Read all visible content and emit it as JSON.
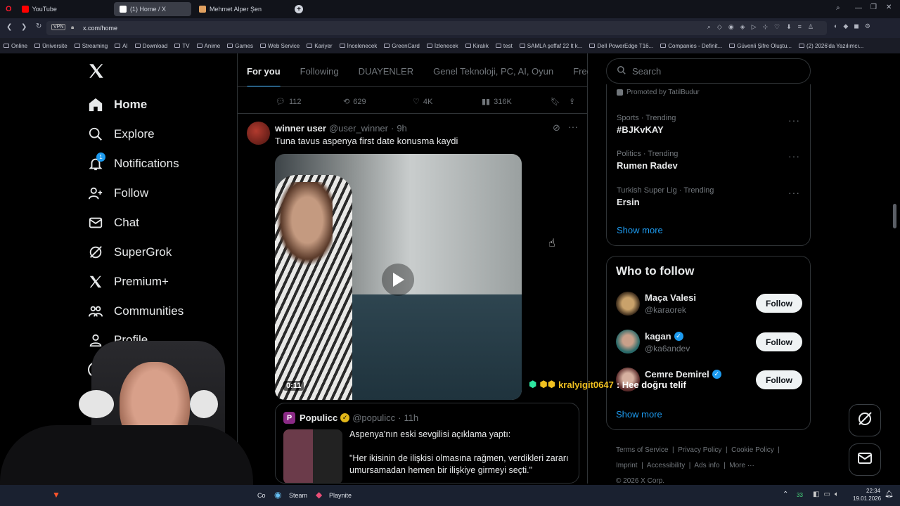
{
  "browser": {
    "tabs": [
      {
        "label": "YouTube",
        "color": "#ff0000"
      },
      {
        "label": "(1) Home / X",
        "color": "#ffffff"
      },
      {
        "label": "Mehmet Alper Şen",
        "color": "#e0a060"
      }
    ],
    "url": "x.com/home",
    "vpn_label": "VPN",
    "bookmarks": [
      "Online",
      "Üniversite",
      "Streaming",
      "AI",
      "Download",
      "TV",
      "Anime",
      "Games",
      "Web Service",
      "Kariyer",
      "İncelenecek",
      "GreenCard",
      "İzlenecek",
      "Kiralık",
      "test",
      "SAMLA şeffaf 22 lt k...",
      "Dell PowerEdge T16...",
      "Companies - Definit...",
      "Güvenli Şifre Oluştu...",
      "(2) 2026'da Yazılımcı..."
    ]
  },
  "nav": {
    "home": "Home",
    "explore": "Explore",
    "notifications": "Notifications",
    "notifications_badge": "1",
    "follow": "Follow",
    "chat": "Chat",
    "supergrok": "SuperGrok",
    "premium": "Premium+",
    "communities": "Communities",
    "profile": "Profile"
  },
  "feed": {
    "tabs": [
      "For you",
      "Following",
      "DUAYENLER",
      "Genel Teknoloji, PC, AI, Oyun",
      "Free G"
    ],
    "prev_actions": {
      "replies": "112",
      "reposts": "629",
      "likes": "4K",
      "views": "316K"
    },
    "post": {
      "author": "winner user",
      "handle": "@user_winner",
      "time": "9h",
      "text": "Tuna tavus aspenya first date konusma kaydi",
      "video_duration": "0:11"
    },
    "quote": {
      "author": "Populicc",
      "handle": "@populicc",
      "time": "11h",
      "line1": "Aspenya’nın eski sevgilisi açıklama yaptı:",
      "line2": "\"Her ikisinin de ilişkisi olmasına rağmen, verdikleri zararı umursamadan hemen bir ilişkiye girmeyi seçti.\""
    }
  },
  "right": {
    "search_placeholder": "Search",
    "promoted": "Promoted by TatilBudur",
    "trends": [
      {
        "category": "Sports · Trending",
        "name": "#BJKvKAY"
      },
      {
        "category": "Politics · Trending",
        "name": "Rumen Radev"
      },
      {
        "category": "Turkish Super Lig · Trending",
        "name": "Ersin"
      }
    ],
    "show_more": "Show more",
    "who_to_follow_title": "Who to follow",
    "who_to_follow": [
      {
        "name": "Maça Valesi",
        "handle": "@karaorek",
        "verified": false
      },
      {
        "name": "kagan",
        "handle": "@ka6andev",
        "verified": true
      },
      {
        "name": "Cemre Demirel",
        "handle": "",
        "verified": true
      }
    ],
    "follow_label": "Follow",
    "show_more_2": "Show more",
    "footer": [
      "Terms of Service",
      "Privacy Policy",
      "Cookie Policy",
      "Imprint",
      "Accessibility",
      "Ads info",
      "More ···",
      "© 2026 X Corp."
    ]
  },
  "overlay": {
    "chat_user": "kralyigit0647",
    "chat_message": ": Hee doğru telif"
  },
  "taskbar": {
    "steam": "Steam",
    "playnite": "Playnite",
    "co": "Co",
    "time": "22:34",
    "date": "19.01.2026",
    "tray_num": "33"
  },
  "colors": {
    "accent": "#1d9bf0",
    "bg": "#000000",
    "border": "#2f3336",
    "muted": "#71767b"
  }
}
